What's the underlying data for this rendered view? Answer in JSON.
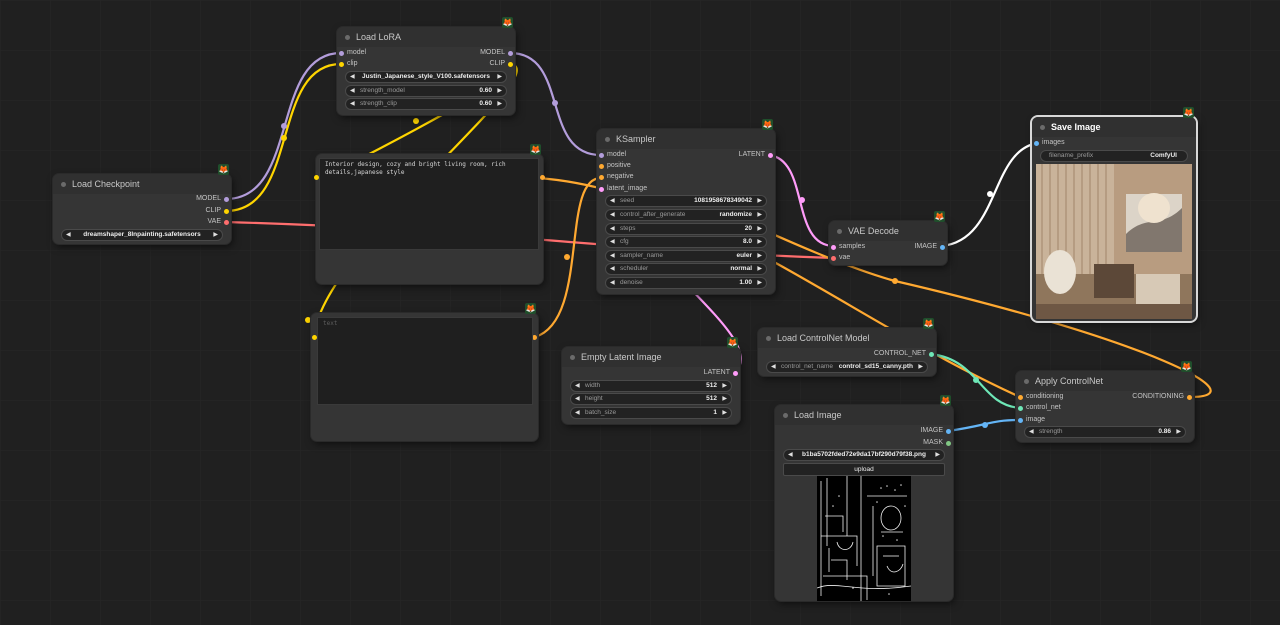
{
  "nodes": {
    "load_lora": {
      "title": "Load LoRA",
      "inputs": [
        "model",
        "clip"
      ],
      "outputs": [
        "MODEL",
        "CLIP"
      ],
      "widgets": {
        "lora_name": "Justin_Japanese_style_V100.safetensors",
        "strength_model_label": "strength_model",
        "strength_model": "0.60",
        "strength_clip_label": "strength_clip",
        "strength_clip": "0.60"
      }
    },
    "load_checkpoint": {
      "title": "Load Checkpoint",
      "outputs": [
        "MODEL",
        "CLIP",
        "VAE"
      ],
      "widgets": {
        "ckpt_name": "dreamshaper_8Inpainting.safetensors"
      }
    },
    "positive_prompt": {
      "text": "Interior design, cozy and bright living room, rich details,japanese style"
    },
    "negative_prompt": {
      "placeholder": "text"
    },
    "ksampler": {
      "title": "KSampler",
      "inputs": [
        "model",
        "positive",
        "negative",
        "latent_image"
      ],
      "outputs": [
        "LATENT"
      ],
      "widgets": [
        {
          "label": "seed",
          "value": "1081958678349042"
        },
        {
          "label": "control_after_generate",
          "value": "randomize"
        },
        {
          "label": "steps",
          "value": "20"
        },
        {
          "label": "cfg",
          "value": "8.0"
        },
        {
          "label": "sampler_name",
          "value": "euler"
        },
        {
          "label": "scheduler",
          "value": "normal"
        },
        {
          "label": "denoise",
          "value": "1.00"
        }
      ]
    },
    "vae_decode": {
      "title": "VAE Decode",
      "inputs": [
        "samples",
        "vae"
      ],
      "outputs": [
        "IMAGE"
      ]
    },
    "save_image": {
      "title": "Save Image",
      "inputs": [
        "images"
      ],
      "widgets": {
        "filename_prefix_label": "filename_prefix",
        "filename_prefix": "ComfyUI"
      }
    },
    "empty_latent": {
      "title": "Empty Latent Image",
      "outputs": [
        "LATENT"
      ],
      "widgets": [
        {
          "label": "width",
          "value": "512"
        },
        {
          "label": "height",
          "value": "512"
        },
        {
          "label": "batch_size",
          "value": "1"
        }
      ]
    },
    "load_controlnet": {
      "title": "Load ControlNet Model",
      "outputs": [
        "CONTROL_NET"
      ],
      "widgets": {
        "control_net_name_label": "control_net_name",
        "control_net_name": "control_sd15_canny.pth"
      }
    },
    "apply_controlnet": {
      "title": "Apply ControlNet",
      "inputs": [
        "conditioning",
        "control_net",
        "image"
      ],
      "outputs": [
        "CONDITIONING"
      ],
      "widgets": {
        "strength_label": "strength",
        "strength": "0.86"
      }
    },
    "load_image": {
      "title": "Load Image",
      "outputs": [
        "IMAGE",
        "MASK"
      ],
      "widgets": {
        "image": "b1ba5702fded72e9da17bf290d79f38.png",
        "upload_label": "upload"
      }
    }
  },
  "colors": {
    "model": "#b39ddb",
    "clip": "#ffd500",
    "vae": "#ff6e6e",
    "conditioning": "#ffa931",
    "latent": "#ff9cf9",
    "image": "#64b5f6",
    "control_net": "#6ee7b7",
    "mask": "#81c784"
  },
  "icons": {
    "node_badge": "fox-icon",
    "arrow_left": "◀",
    "arrow_right": "▶"
  }
}
